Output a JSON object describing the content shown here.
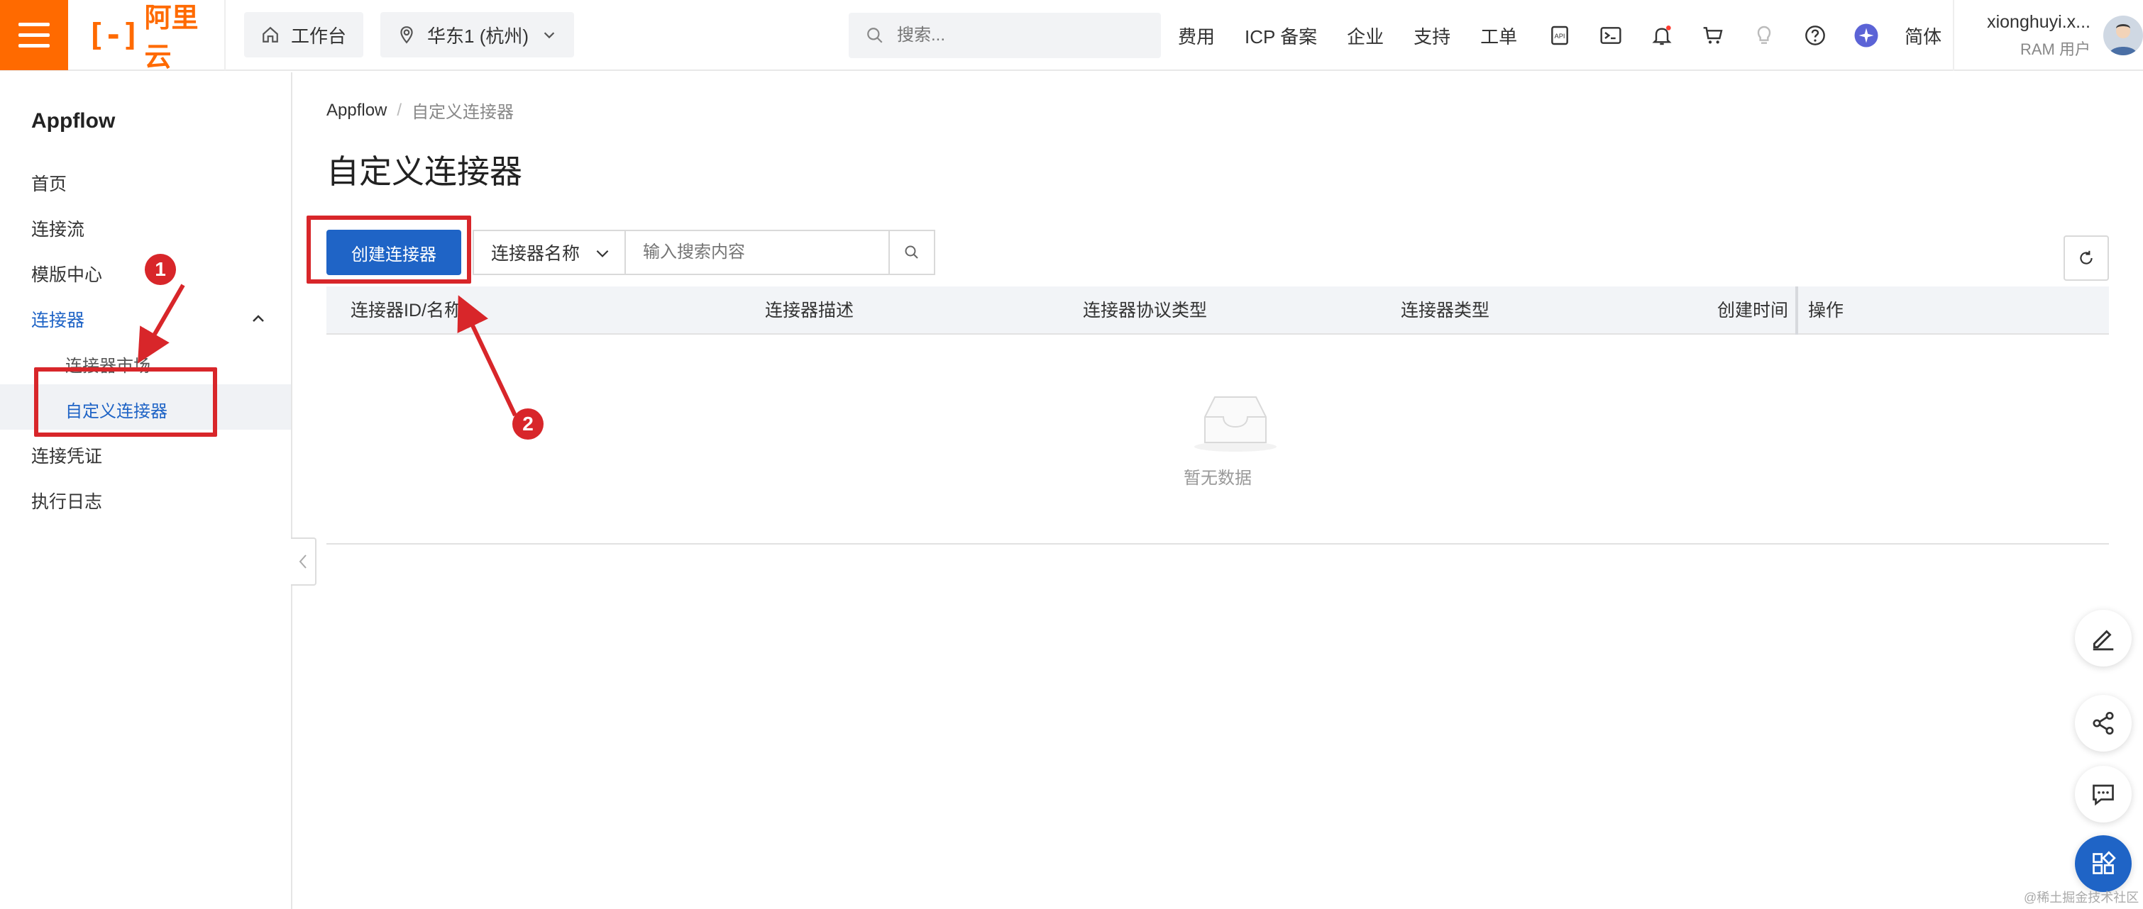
{
  "topbar": {
    "logo_mark": "[-]",
    "logo_text": "阿里云",
    "workbench": "工作台",
    "region": "华东1 (杭州)",
    "search_placeholder": "搜索...",
    "nav": [
      "费用",
      "ICP 备案",
      "企业",
      "支持",
      "工单"
    ],
    "lang": "简体",
    "user_name": "xionghuyi.x...",
    "user_role": "RAM 用户"
  },
  "sidebar": {
    "title": "Appflow",
    "items": {
      "home": "首页",
      "flows": "连接流",
      "templates": "模版中心",
      "connectors": "连接器",
      "market": "连接器市场",
      "custom": "自定义连接器",
      "credentials": "连接凭证",
      "logs": "执行日志"
    }
  },
  "main": {
    "breadcrumb_root": "Appflow",
    "breadcrumb_sep": "/",
    "breadcrumb_current": "自定义连接器",
    "title": "自定义连接器",
    "create_button": "创建连接器",
    "filter_field": "连接器名称",
    "filter_placeholder": "输入搜索内容",
    "columns": [
      "连接器ID/名称",
      "连接器描述",
      "连接器协议类型",
      "连接器类型",
      "创建时间",
      "操作"
    ],
    "empty_text": "暂无数据"
  },
  "annotations": {
    "step1": "1",
    "step2": "2",
    "color": "#d8262a"
  },
  "watermark": "@稀土掘金技术社区",
  "colors": {
    "brand": "#ff6a00",
    "primary": "#1f64c6"
  }
}
